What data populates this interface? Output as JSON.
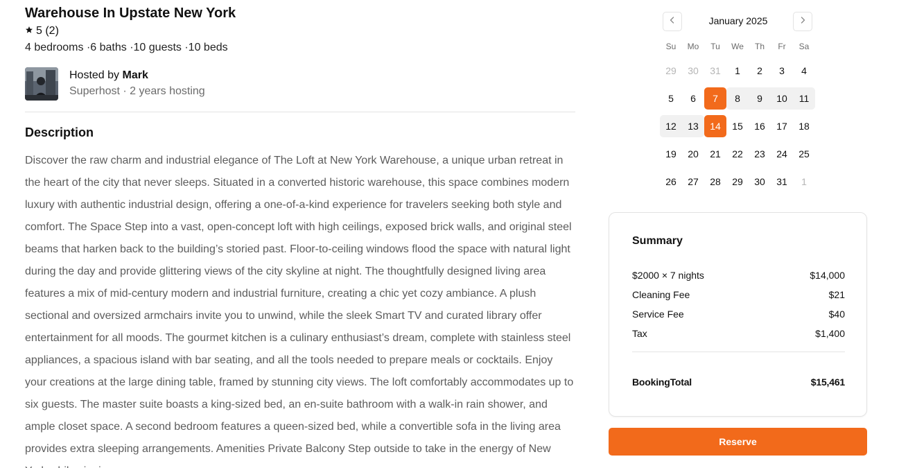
{
  "listing": {
    "title": "Warehouse In Upstate New York",
    "rating": "5 (2)",
    "specs": "4 bedrooms ·6 baths ·10 guests ·10 beds"
  },
  "host": {
    "prefix": "Hosted by ",
    "name": "Mark",
    "meta": "Superhost · 2 years hosting"
  },
  "description": {
    "heading": "Description",
    "text": "Discover the raw charm and industrial elegance of The Loft at New York Warehouse, a unique urban retreat in the heart of the city that never sleeps. Situated in a converted historic warehouse, this space combines modern luxury with authentic industrial design, offering a one-of-a-kind experience for travelers seeking both style and comfort. The Space Step into a vast, open-concept loft with high ceilings, exposed brick walls, and original steel beams that harken back to the building’s storied past. Floor-to-ceiling windows flood the space with natural light during the day and provide glittering views of the city skyline at night. The thoughtfully designed living area features a mix of mid-century modern and industrial furniture, creating a chic yet cozy ambiance. A plush sectional and oversized armchairs invite you to unwind, while the sleek Smart TV and curated library offer entertainment for all moods. The gourmet kitchen is a culinary enthusiast’s dream, complete with stainless steel appliances, a spacious island with bar seating, and all the tools needed to prepare meals or cocktails. Enjoy your creations at the large dining table, framed by stunning city views. The loft comfortably accommodates up to six guests. The master suite boasts a king-sized bed, an en-suite bathroom with a walk-in rain shower, and ample closet space. A second bedroom features a queen-sized bed, while a convertible sofa in the living area provides extra sleeping arrangements. Amenities Private Balcony Step outside to take in the energy of New York while sipping"
  },
  "calendar": {
    "month": "January 2025",
    "weekdays": [
      "Su",
      "Mo",
      "Tu",
      "We",
      "Th",
      "Fr",
      "Sa"
    ],
    "weeks": [
      [
        {
          "d": "29",
          "muted": true
        },
        {
          "d": "30",
          "muted": true
        },
        {
          "d": "31",
          "muted": true
        },
        {
          "d": "1"
        },
        {
          "d": "2"
        },
        {
          "d": "3"
        },
        {
          "d": "4"
        }
      ],
      [
        {
          "d": "5"
        },
        {
          "d": "6"
        },
        {
          "d": "7",
          "selected": true
        },
        {
          "d": "8",
          "range": true
        },
        {
          "d": "9",
          "range": true
        },
        {
          "d": "10",
          "range": true
        },
        {
          "d": "11",
          "range": true
        }
      ],
      [
        {
          "d": "12",
          "range": true
        },
        {
          "d": "13",
          "range": true
        },
        {
          "d": "14",
          "selected": true
        },
        {
          "d": "15"
        },
        {
          "d": "16"
        },
        {
          "d": "17"
        },
        {
          "d": "18"
        }
      ],
      [
        {
          "d": "19"
        },
        {
          "d": "20"
        },
        {
          "d": "21"
        },
        {
          "d": "22"
        },
        {
          "d": "23"
        },
        {
          "d": "24"
        },
        {
          "d": "25"
        }
      ],
      [
        {
          "d": "26"
        },
        {
          "d": "27"
        },
        {
          "d": "28"
        },
        {
          "d": "29"
        },
        {
          "d": "30"
        },
        {
          "d": "31"
        },
        {
          "d": "1",
          "muted": true
        }
      ]
    ],
    "accent_color": "#f26a1b"
  },
  "summary": {
    "title": "Summary",
    "rows": [
      {
        "label": "$2000 × 7 nights",
        "value": "$14,000"
      },
      {
        "label": "Cleaning Fee",
        "value": "$21"
      },
      {
        "label": "Service Fee",
        "value": "$40"
      },
      {
        "label": "Tax",
        "value": "$1,400"
      }
    ],
    "total_label": "BookingTotal",
    "total_value": "$15,461"
  },
  "actions": {
    "reserve_label": "Reserve"
  },
  "icons": {
    "rating": "star-icon",
    "prev": "chevron-left-icon",
    "next": "chevron-right-icon"
  }
}
